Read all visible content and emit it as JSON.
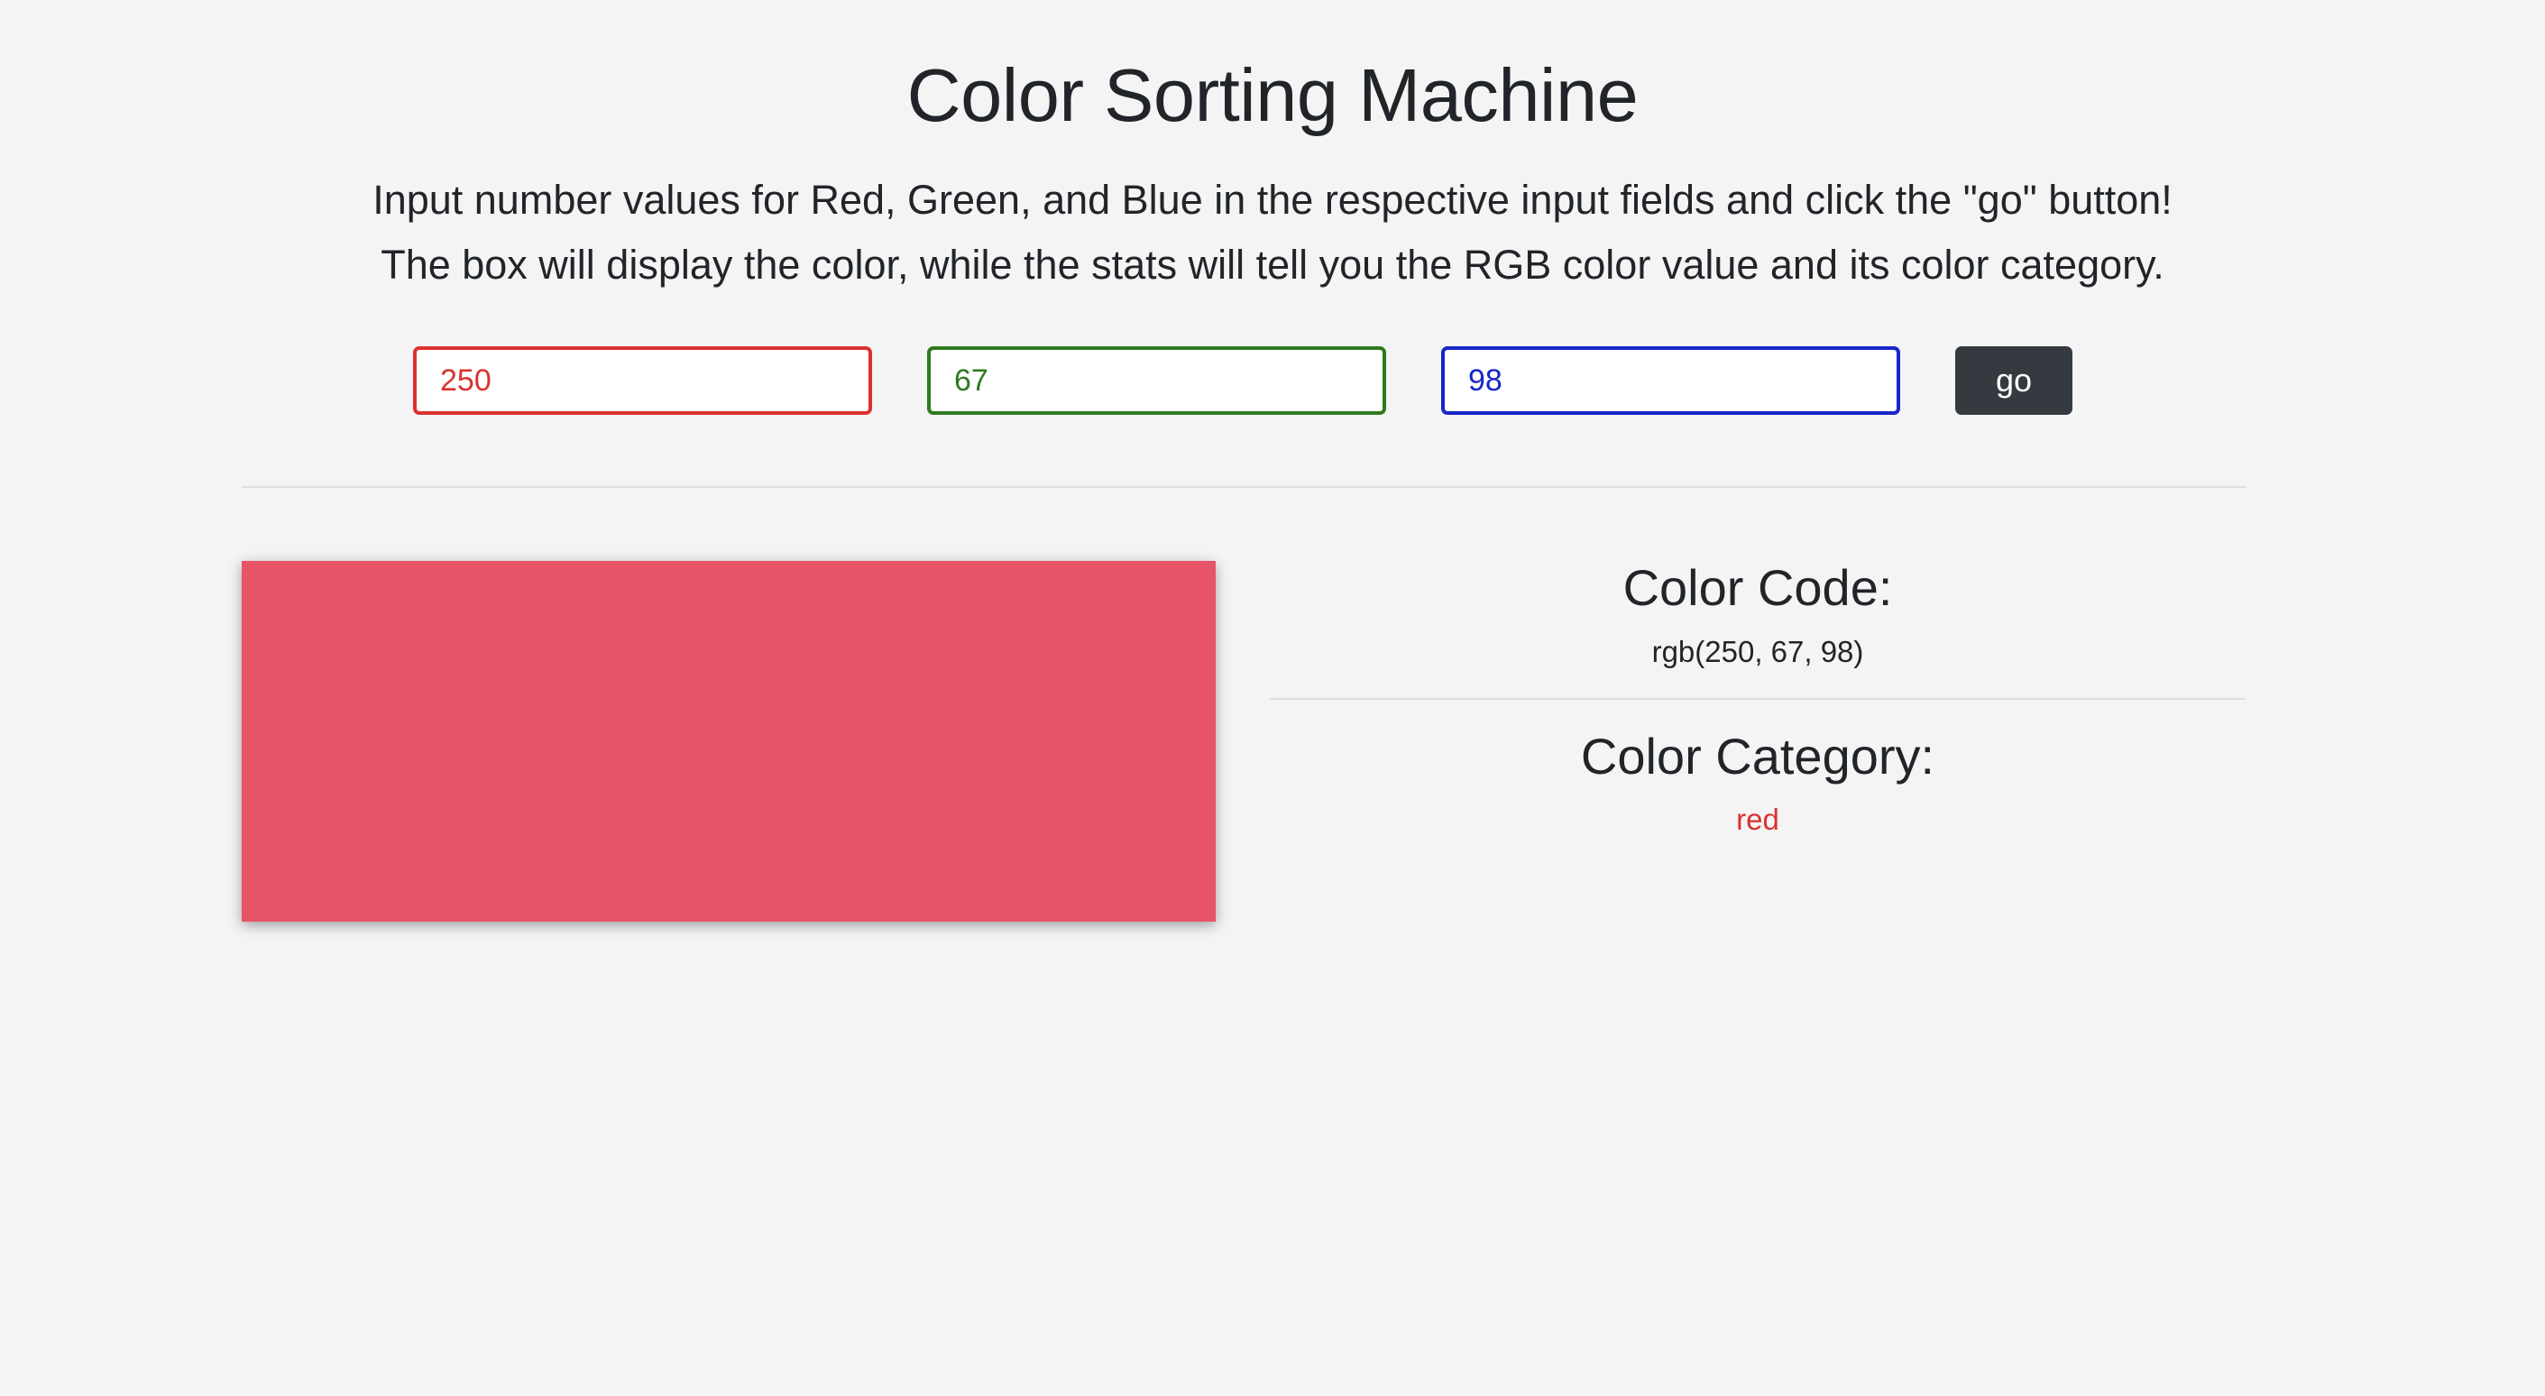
{
  "header": {
    "title": "Color Sorting Machine",
    "intro_line1": "Input number values for Red, Green, and Blue in the respective input fields and click the \"go\" button!",
    "intro_line2": "The box will display the color, while the stats will tell you the RGB color value and its color category."
  },
  "inputs": {
    "red_value": "250",
    "green_value": "67",
    "blue_value": "98",
    "go_label": "go"
  },
  "colors": {
    "red_accent": "#dc3131",
    "green_accent": "#2f7a1f",
    "blue_accent": "#1626c9",
    "button_bg": "#343a40",
    "swatch_fill": "#e65467"
  },
  "stats": {
    "code_heading": "Color Code:",
    "code_value": "rgb(250, 67, 98)",
    "category_heading": "Color Category:",
    "category_value": "red"
  }
}
